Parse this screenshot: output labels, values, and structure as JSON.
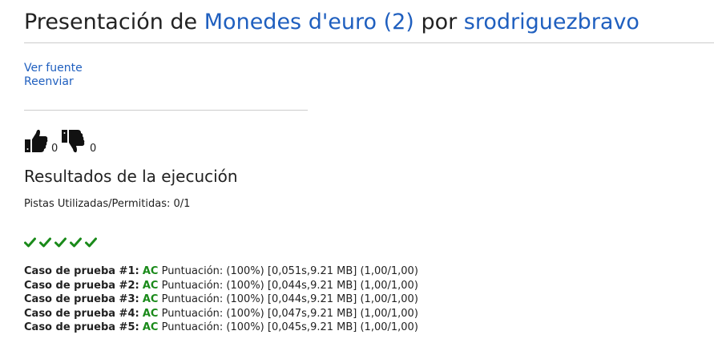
{
  "header": {
    "prefix": "Presentación de",
    "problem": "Monedes d'euro (2)",
    "middle": "por",
    "user": "srodriguezbravo"
  },
  "links": {
    "view_source": "Ver fuente",
    "resubmit": "Reenviar"
  },
  "votes": {
    "up_count": "0",
    "down_count": "0"
  },
  "results": {
    "title": "Resultados de la ejecución",
    "hints": "Pistas Utilizadas/Permitidas: 0/1",
    "check_color": "#1a8a1a",
    "cases": [
      {
        "label": "Caso de prueba #1:",
        "status": "AC",
        "detail": "Puntuación: (100%) [0,051s,9.21 MB] (1,00/1,00)"
      },
      {
        "label": "Caso de prueba #2:",
        "status": "AC",
        "detail": "Puntuación: (100%) [0,044s,9.21 MB] (1,00/1,00)"
      },
      {
        "label": "Caso de prueba #3:",
        "status": "AC",
        "detail": "Puntuación: (100%) [0,044s,9.21 MB] (1,00/1,00)"
      },
      {
        "label": "Caso de prueba #4:",
        "status": "AC",
        "detail": "Puntuación: (100%) [0,047s,9.21 MB] (1,00/1,00)"
      },
      {
        "label": "Caso de prueba #5:",
        "status": "AC",
        "detail": "Puntuación: (100%) [0,045s,9.21 MB] (1,00/1,00)"
      }
    ]
  }
}
